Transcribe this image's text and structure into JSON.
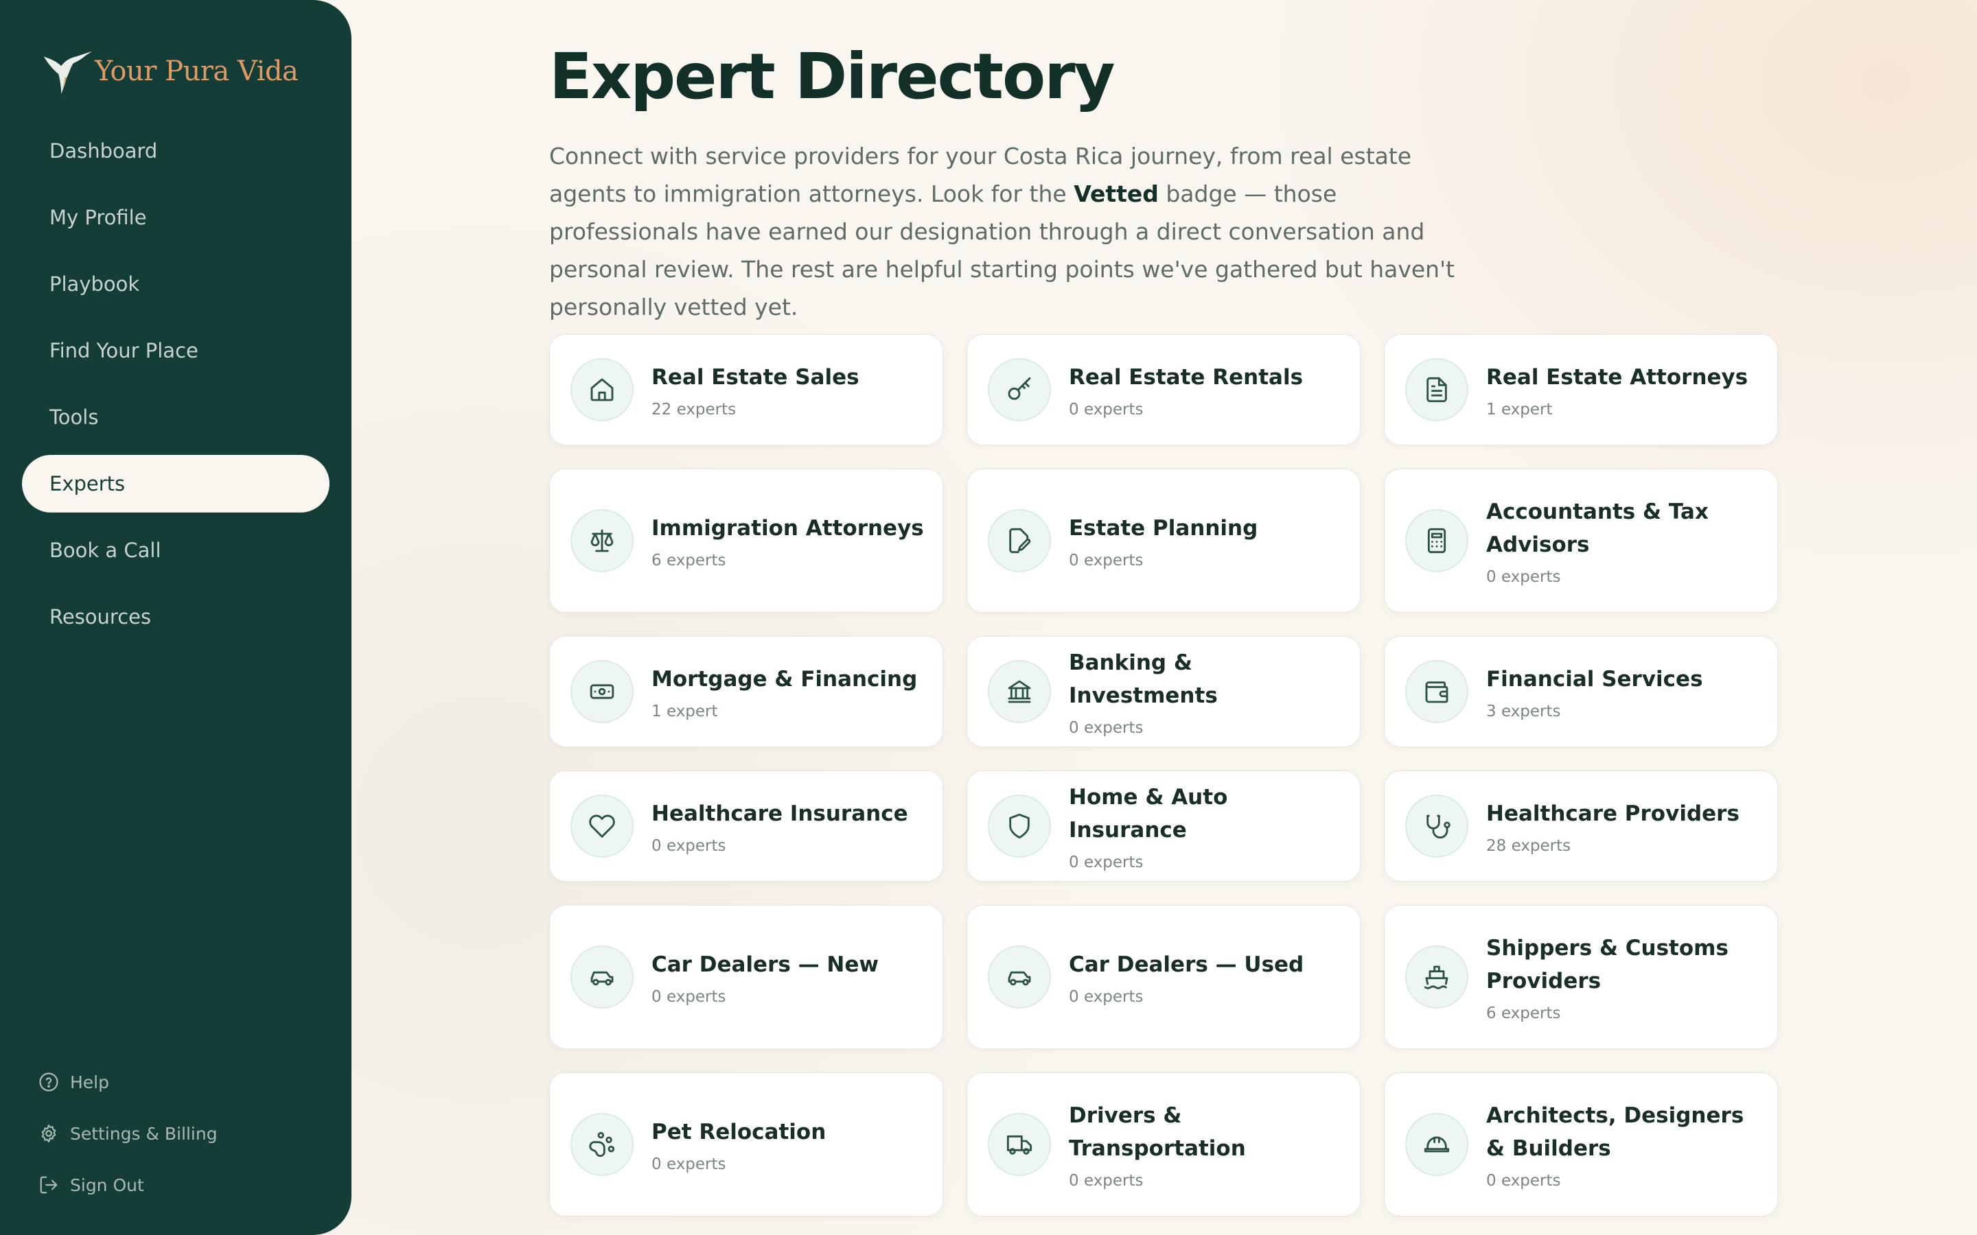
{
  "brand": {
    "name": "Your Pura Vida",
    "accent": "#e09a62",
    "sidebar_bg": "#133d36"
  },
  "nav": [
    {
      "label": "Dashboard"
    },
    {
      "label": "My Profile"
    },
    {
      "label": "Playbook"
    },
    {
      "label": "Find Your Place"
    },
    {
      "label": "Tools"
    },
    {
      "label": "Experts",
      "active": true
    },
    {
      "label": "Book a Call"
    },
    {
      "label": "Resources"
    }
  ],
  "footer_links": [
    {
      "label": "Help",
      "icon": "help-circle-icon"
    },
    {
      "label": "Settings & Billing",
      "icon": "gear-icon"
    },
    {
      "label": "Sign Out",
      "icon": "sign-out-icon"
    }
  ],
  "page": {
    "title": "Expert Directory",
    "intro_before": "Connect with service providers for your Costa Rica journey, from real estate agents to immigration attorneys. Look for the ",
    "intro_bold": "Vetted",
    "intro_after": " badge — those professionals have earned our designation through a direct conversation and personal review. The rest are helpful starting points we've gathered but haven't personally vetted yet."
  },
  "categories": [
    {
      "title": "Real Estate Sales",
      "count": "22 experts",
      "icon": "house-icon"
    },
    {
      "title": "Real Estate Rentals",
      "count": "0 experts",
      "icon": "key-icon"
    },
    {
      "title": "Real Estate Attorneys",
      "count": "1 expert",
      "icon": "document-icon"
    },
    {
      "title": "Immigration Attorneys",
      "count": "6 experts",
      "icon": "scales-icon"
    },
    {
      "title": "Estate Planning",
      "count": "0 experts",
      "icon": "document-edit-icon"
    },
    {
      "title": "Accountants & Tax Advisors",
      "count": "0 experts",
      "icon": "calculator-icon"
    },
    {
      "title": "Mortgage & Financing",
      "count": "1 expert",
      "icon": "banknote-icon"
    },
    {
      "title": "Banking & Investments",
      "count": "0 experts",
      "icon": "bank-icon"
    },
    {
      "title": "Financial Services",
      "count": "3 experts",
      "icon": "wallet-icon"
    },
    {
      "title": "Healthcare Insurance",
      "count": "0 experts",
      "icon": "heart-icon"
    },
    {
      "title": "Home & Auto Insurance",
      "count": "0 experts",
      "icon": "shield-icon"
    },
    {
      "title": "Healthcare Providers",
      "count": "28 experts",
      "icon": "stethoscope-icon"
    },
    {
      "title": "Car Dealers — New",
      "count": "0 experts",
      "icon": "car-icon"
    },
    {
      "title": "Car Dealers — Used",
      "count": "0 experts",
      "icon": "car-icon"
    },
    {
      "title": "Shippers & Customs Providers",
      "count": "6 experts",
      "icon": "ship-icon"
    },
    {
      "title": "Pet Relocation",
      "count": "0 experts",
      "icon": "paw-icon"
    },
    {
      "title": "Drivers & Transportation",
      "count": "0 experts",
      "icon": "truck-icon"
    },
    {
      "title": "Architects, Designers & Builders",
      "count": "0 experts",
      "icon": "hard-hat-icon"
    }
  ]
}
